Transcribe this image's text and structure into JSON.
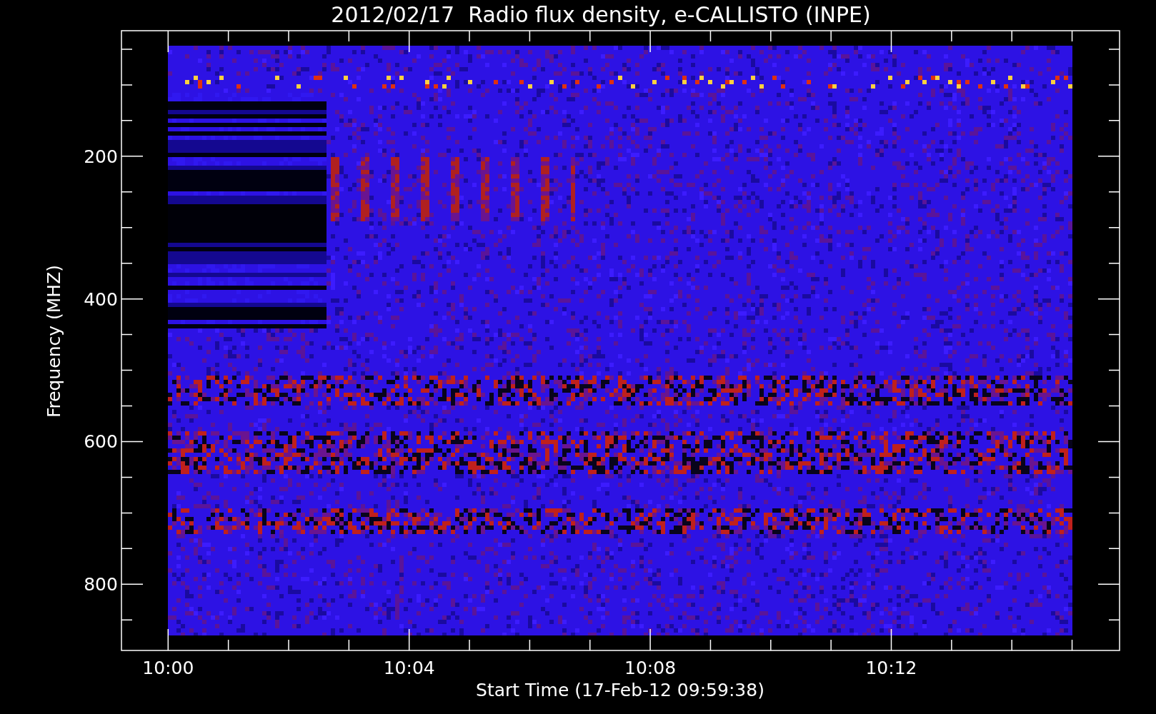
{
  "plot": {
    "title": "2012/02/17  Radio flux density, e-CALLISTO (INPE)",
    "xlabel": "Start Time (17-Feb-12 09:59:38)",
    "ylabel": "Frequency (MHZ)",
    "x_tick_labels": [
      "10:00",
      "10:04",
      "10:08",
      "10:12"
    ],
    "y_tick_labels": [
      "200",
      "400",
      "600",
      "800"
    ]
  }
}
